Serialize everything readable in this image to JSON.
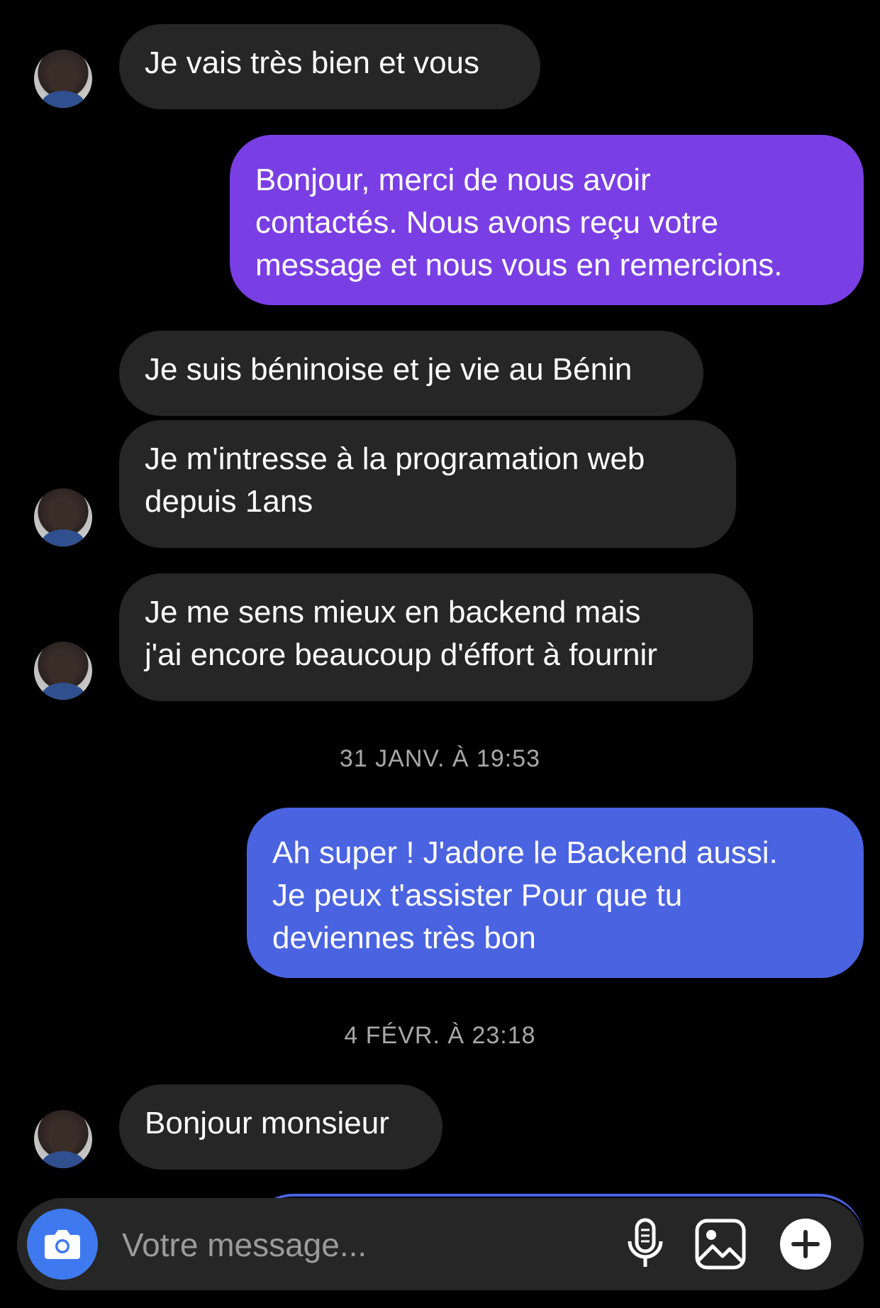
{
  "messages": [
    {
      "text": "Je vais très bien et vous"
    },
    {
      "text": "Bonjour, merci de nous avoir\ncontactés. Nous avons reçu votre\nmessage et nous vous en remercions."
    },
    {
      "text": "Je suis béninoise et je vie au Bénin"
    },
    {
      "text": "Je m'intresse à la programation web\ndepuis 1ans"
    },
    {
      "text": "Je me sens mieux en backend mais\nj'ai encore beaucoup d'éffort à fournir"
    },
    {
      "text": "Ah super ! J'adore le Backend aussi.\nJe peux t'assister Pour que tu\ndeviennes très bon"
    },
    {
      "text": "Bonjour monsieur"
    }
  ],
  "timestamps": [
    "31 JANV. À 19:53",
    "4 FÉVR. À 23:18"
  ],
  "composer": {
    "placeholder": "Votre message..."
  },
  "icons": [
    "camera-icon",
    "microphone-icon",
    "image-icon",
    "plus-icon"
  ],
  "colors": {
    "outgoing_purple": "#7a3fe4",
    "outgoing_blue": "#4a63e0",
    "incoming": "#262626",
    "camera_button": "#3f79f0"
  }
}
